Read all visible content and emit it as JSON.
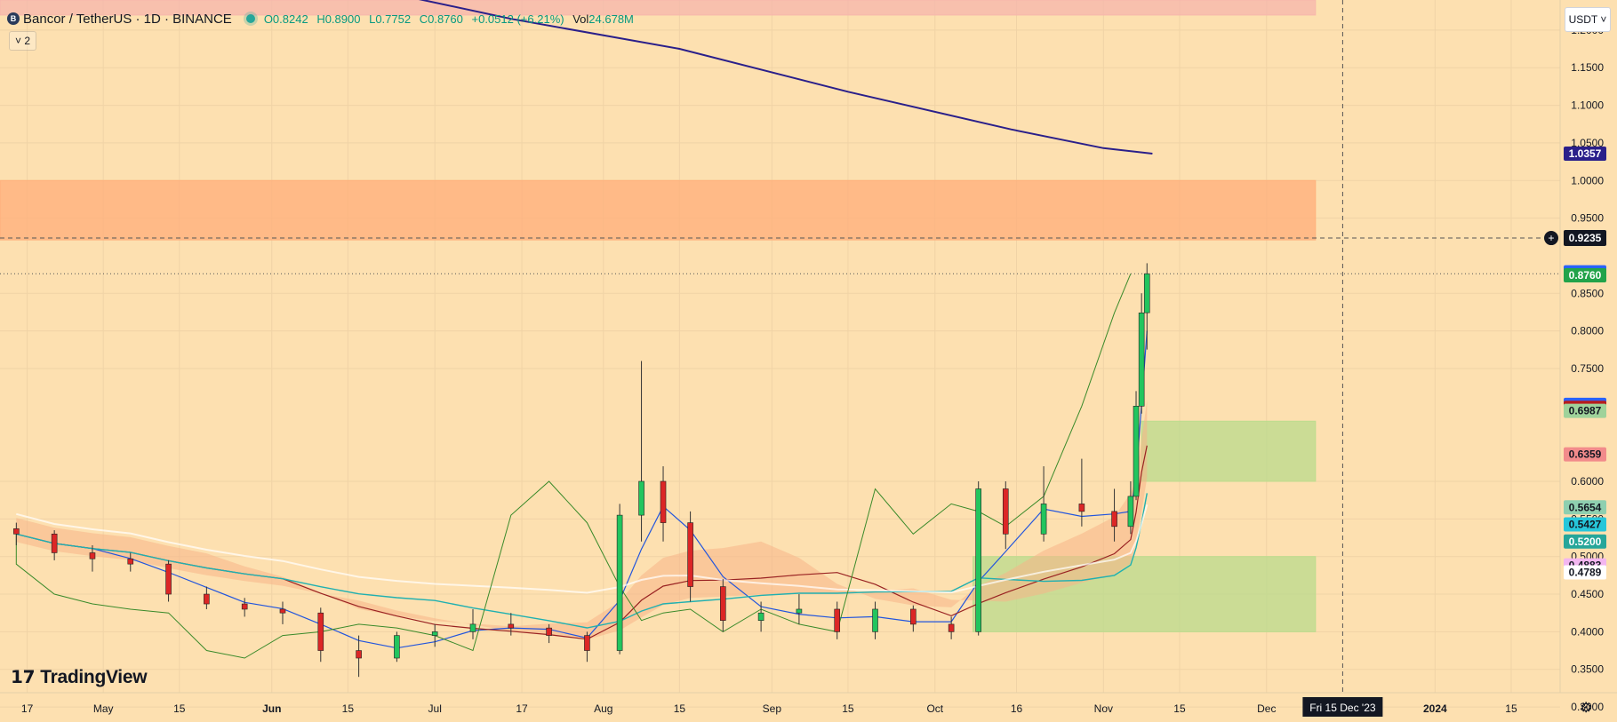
{
  "header": {
    "symbol": "Bancor / TetherUS · 1D · BINANCE",
    "logo_letter": "B",
    "open": "O0.8242",
    "high": "H0.8900",
    "low": "L0.7752",
    "close": "C0.8760",
    "change": "+0.0512 (+6.21%)",
    "volume_label": "Vol",
    "volume_value": "24.678M",
    "indicators_toggle": "˅ 2"
  },
  "currency_selector": "USDT ˅",
  "branding": {
    "mark": "𝟭𝟳",
    "name": "TradingView"
  },
  "colors": {
    "background": "#fde0b0",
    "up_candle": "#22c55e",
    "down_candle": "#dc2626",
    "ma_long": "#2a1f8a",
    "tenkan": "#2255dd",
    "kijun": "#992222",
    "chikou": "#3a8a2a",
    "ma_teal": "#20b0b0",
    "resistance_zone": "#ff9a5a",
    "support_zone": "#a8d67a"
  },
  "chart_data": {
    "type": "candlestick",
    "title": "Bancor / TetherUS · 1D · BINANCE",
    "ylim": [
      0.28,
      1.24
    ],
    "x_range": [
      "2023-04-12",
      "2024-01-24"
    ],
    "y_ticks": [
      "1.2000",
      "1.1500",
      "1.1000",
      "1.0500",
      "1.0000",
      "0.9500",
      "0.8500",
      "0.8000",
      "0.7500",
      "0.6000",
      "0.5500",
      "0.5000",
      "0.4500",
      "0.4000",
      "0.3500",
      "0.3000"
    ],
    "x_ticks": [
      {
        "label": "17",
        "date": "2023-04-17"
      },
      {
        "label": "May",
        "date": "2023-05-01"
      },
      {
        "label": "15",
        "date": "2023-05-15"
      },
      {
        "label": "Jun",
        "date": "2023-06-01"
      },
      {
        "label": "15",
        "date": "2023-06-15"
      },
      {
        "label": "Jul",
        "date": "2023-07-01"
      },
      {
        "label": "17",
        "date": "2023-07-17"
      },
      {
        "label": "Aug",
        "date": "2023-08-01"
      },
      {
        "label": "15",
        "date": "2023-08-15"
      },
      {
        "label": "Sep",
        "date": "2023-09-01"
      },
      {
        "label": "15",
        "date": "2023-09-15"
      },
      {
        "label": "Oct",
        "date": "2023-10-01"
      },
      {
        "label": "16",
        "date": "2023-10-16"
      },
      {
        "label": "Nov",
        "date": "2023-11-01"
      },
      {
        "label": "15",
        "date": "2023-11-15"
      },
      {
        "label": "Dec",
        "date": "2023-12-01"
      },
      {
        "label": "2024",
        "date": "2024-01-01"
      },
      {
        "label": "15",
        "date": "2024-01-15"
      }
    ],
    "crosshair": {
      "date": "2023-12-15",
      "date_label": "Fri 15 Dec '23",
      "price": 0.9235,
      "price_label": "0.9235"
    },
    "last_price_line": 0.876,
    "price_labels": [
      {
        "label": "1.0357",
        "value": 1.0357,
        "bg": "#2a1f8a",
        "fg": "#ffffff"
      },
      {
        "label": "0.8760",
        "value": 0.878,
        "bg": "#2962ff",
        "fg": "#ffffff"
      },
      {
        "label": "0.8760",
        "value": 0.874,
        "bg": "#22a34a",
        "fg": "#ffffff"
      },
      {
        "label": "0.6987",
        "value": 0.7017,
        "bg": "#2962ff",
        "fg": "#ffffff"
      },
      {
        "label": "0.6987",
        "value": 0.6977,
        "bg": "#b71c1c",
        "fg": "#ffffff"
      },
      {
        "label": "0.6987",
        "value": 0.6937,
        "bg": "#9fd29a",
        "fg": "#131722"
      },
      {
        "label": "0.6359",
        "value": 0.6359,
        "bg": "#f28b8b",
        "fg": "#131722"
      },
      {
        "label": "0.5654",
        "value": 0.5654,
        "bg": "#8fcfb0",
        "fg": "#131722"
      },
      {
        "label": "0.5427",
        "value": 0.5427,
        "bg": "#26c6da",
        "fg": "#131722"
      },
      {
        "label": "0.5200",
        "value": 0.52,
        "bg": "#26a69a",
        "fg": "#ffffff"
      },
      {
        "label": "0.4883",
        "value": 0.4883,
        "bg": "#f3b6f0",
        "fg": "#131722"
      },
      {
        "label": "0.4789",
        "value": 0.4789,
        "bg": "#ffffff",
        "fg": "#131722"
      }
    ],
    "zones": [
      {
        "name": "top-band",
        "date_start": "2023-04-12",
        "date_end": "2023-12-10",
        "y0": 1.22,
        "y1": 1.24,
        "color": "#f6b5ac"
      },
      {
        "name": "resistance",
        "date_start": "2023-04-12",
        "date_end": "2023-12-10",
        "y0": 0.921,
        "y1": 1.0,
        "color": "#ffae7a"
      },
      {
        "name": "support-upper",
        "date_start": "2023-11-08",
        "date_end": "2023-12-10",
        "y0": 0.6,
        "y1": 0.68,
        "color": "#b9db8c"
      },
      {
        "name": "support-lower",
        "date_start": "2023-10-08",
        "date_end": "2023-12-10",
        "y0": 0.4,
        "y1": 0.5,
        "color": "#b9db8c"
      }
    ],
    "ma_long": {
      "dates": [
        "2023-06-21",
        "2023-07-15",
        "2023-08-15",
        "2023-09-15",
        "2023-10-15",
        "2023-11-01",
        "2023-11-10"
      ],
      "values": [
        1.252,
        1.215,
        1.175,
        1.118,
        1.068,
        1.043,
        1.0357
      ]
    },
    "candles": [
      {
        "date": "2023-04-15",
        "o": 0.537,
        "h": 0.545,
        "l": 0.515,
        "c": 0.53
      },
      {
        "date": "2023-04-22",
        "o": 0.53,
        "h": 0.535,
        "l": 0.495,
        "c": 0.505
      },
      {
        "date": "2023-04-29",
        "o": 0.505,
        "h": 0.515,
        "l": 0.48,
        "c": 0.497
      },
      {
        "date": "2023-05-06",
        "o": 0.497,
        "h": 0.505,
        "l": 0.48,
        "c": 0.49
      },
      {
        "date": "2023-05-13",
        "o": 0.49,
        "h": 0.495,
        "l": 0.44,
        "c": 0.45
      },
      {
        "date": "2023-05-20",
        "o": 0.45,
        "h": 0.46,
        "l": 0.43,
        "c": 0.437
      },
      {
        "date": "2023-05-27",
        "o": 0.437,
        "h": 0.445,
        "l": 0.42,
        "c": 0.43
      },
      {
        "date": "2023-06-03",
        "o": 0.43,
        "h": 0.44,
        "l": 0.41,
        "c": 0.425
      },
      {
        "date": "2023-06-10",
        "o": 0.425,
        "h": 0.432,
        "l": 0.36,
        "c": 0.375
      },
      {
        "date": "2023-06-17",
        "o": 0.375,
        "h": 0.395,
        "l": 0.34,
        "c": 0.365
      },
      {
        "date": "2023-06-24",
        "o": 0.365,
        "h": 0.4,
        "l": 0.36,
        "c": 0.395
      },
      {
        "date": "2023-07-01",
        "o": 0.395,
        "h": 0.41,
        "l": 0.38,
        "c": 0.4
      },
      {
        "date": "2023-07-08",
        "o": 0.4,
        "h": 0.43,
        "l": 0.39,
        "c": 0.41
      },
      {
        "date": "2023-07-15",
        "o": 0.41,
        "h": 0.425,
        "l": 0.395,
        "c": 0.405
      },
      {
        "date": "2023-07-22",
        "o": 0.405,
        "h": 0.41,
        "l": 0.385,
        "c": 0.395
      },
      {
        "date": "2023-07-29",
        "o": 0.395,
        "h": 0.4,
        "l": 0.36,
        "c": 0.375
      },
      {
        "date": "2023-08-04",
        "o": 0.375,
        "h": 0.57,
        "l": 0.37,
        "c": 0.555
      },
      {
        "date": "2023-08-08",
        "o": 0.555,
        "h": 0.76,
        "l": 0.52,
        "c": 0.6
      },
      {
        "date": "2023-08-12",
        "o": 0.6,
        "h": 0.62,
        "l": 0.52,
        "c": 0.545
      },
      {
        "date": "2023-08-17",
        "o": 0.545,
        "h": 0.56,
        "l": 0.44,
        "c": 0.46
      },
      {
        "date": "2023-08-23",
        "o": 0.46,
        "h": 0.47,
        "l": 0.4,
        "c": 0.415
      },
      {
        "date": "2023-08-30",
        "o": 0.415,
        "h": 0.44,
        "l": 0.4,
        "c": 0.425
      },
      {
        "date": "2023-09-06",
        "o": 0.425,
        "h": 0.45,
        "l": 0.41,
        "c": 0.43
      },
      {
        "date": "2023-09-13",
        "o": 0.43,
        "h": 0.44,
        "l": 0.39,
        "c": 0.4
      },
      {
        "date": "2023-09-20",
        "o": 0.4,
        "h": 0.44,
        "l": 0.39,
        "c": 0.43
      },
      {
        "date": "2023-09-27",
        "o": 0.43,
        "h": 0.435,
        "l": 0.4,
        "c": 0.41
      },
      {
        "date": "2023-10-04",
        "o": 0.41,
        "h": 0.42,
        "l": 0.39,
        "c": 0.4
      },
      {
        "date": "2023-10-09",
        "o": 0.4,
        "h": 0.6,
        "l": 0.395,
        "c": 0.59
      },
      {
        "date": "2023-10-14",
        "o": 0.59,
        "h": 0.6,
        "l": 0.51,
        "c": 0.53
      },
      {
        "date": "2023-10-21",
        "o": 0.53,
        "h": 0.62,
        "l": 0.52,
        "c": 0.57
      },
      {
        "date": "2023-10-28",
        "o": 0.57,
        "h": 0.63,
        "l": 0.54,
        "c": 0.56
      },
      {
        "date": "2023-11-03",
        "o": 0.56,
        "h": 0.59,
        "l": 0.52,
        "c": 0.54
      },
      {
        "date": "2023-11-06",
        "o": 0.54,
        "h": 0.6,
        "l": 0.53,
        "c": 0.58
      },
      {
        "date": "2023-11-07",
        "o": 0.58,
        "h": 0.72,
        "l": 0.575,
        "c": 0.7
      },
      {
        "date": "2023-11-08",
        "o": 0.7,
        "h": 0.85,
        "l": 0.69,
        "c": 0.824
      },
      {
        "date": "2023-11-09",
        "o": 0.8242,
        "h": 0.89,
        "l": 0.7752,
        "c": 0.876
      }
    ]
  }
}
